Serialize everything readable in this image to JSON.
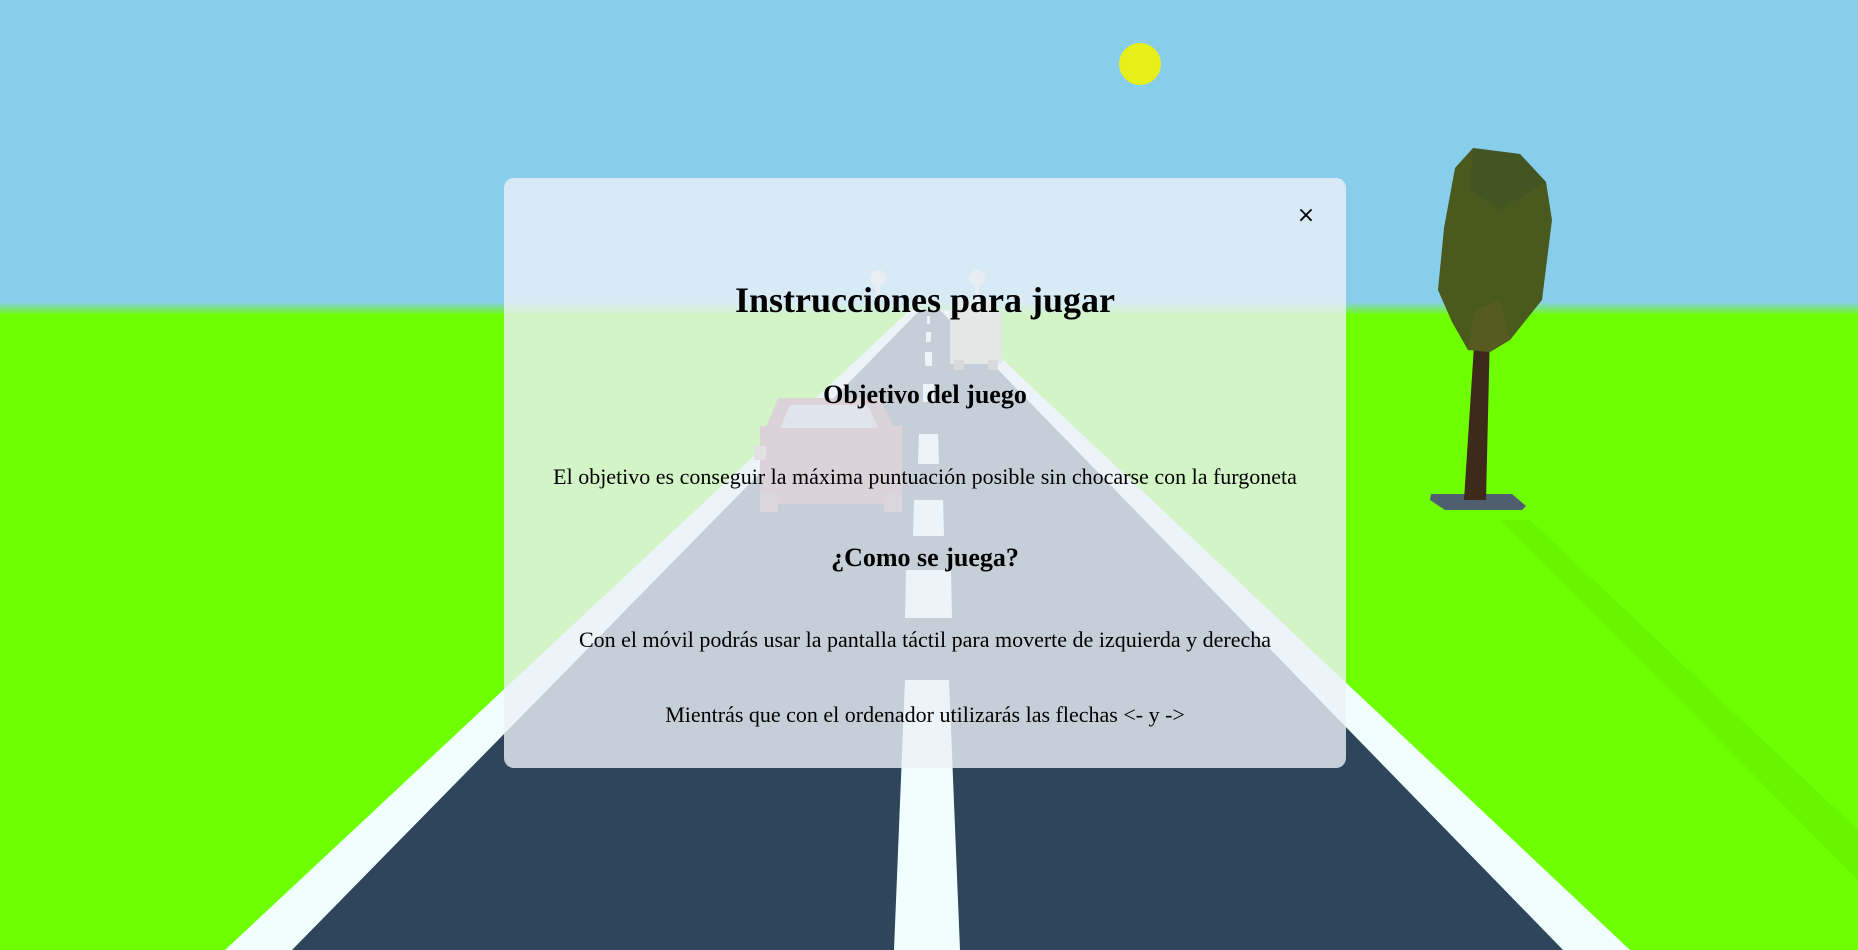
{
  "colors": {
    "sky": "#87ceeb",
    "grass": "#6eff00",
    "road": "#2e455c",
    "lane_lines": "#f0fffe",
    "sun": "#e8f01c",
    "tree_foliage": "#4a5a1e",
    "tree_trunk": "#3d2a1a",
    "tree_base": "#4f5f70",
    "modal_bg": "rgba(236,241,248,0.80)"
  },
  "scene": {
    "sun_icon": "sun-icon",
    "tree_icon": "tree-icon",
    "car_icon": "car-icon",
    "van_icon": "van-icon"
  },
  "modal": {
    "close_label": "×",
    "title": "Instrucciones para jugar",
    "objective_heading": "Objetivo del juego",
    "objective_text": "El objetivo es conseguir la máxima puntuación posible sin chocarse con la furgoneta",
    "how_heading": "¿Como se juega?",
    "mobile_text": "Con el móvil podrás usar la pantalla táctil para moverte de izquierda y derecha",
    "desktop_text": "Mientrás que con el ordenador utilizarás las flechas <- y ->"
  }
}
